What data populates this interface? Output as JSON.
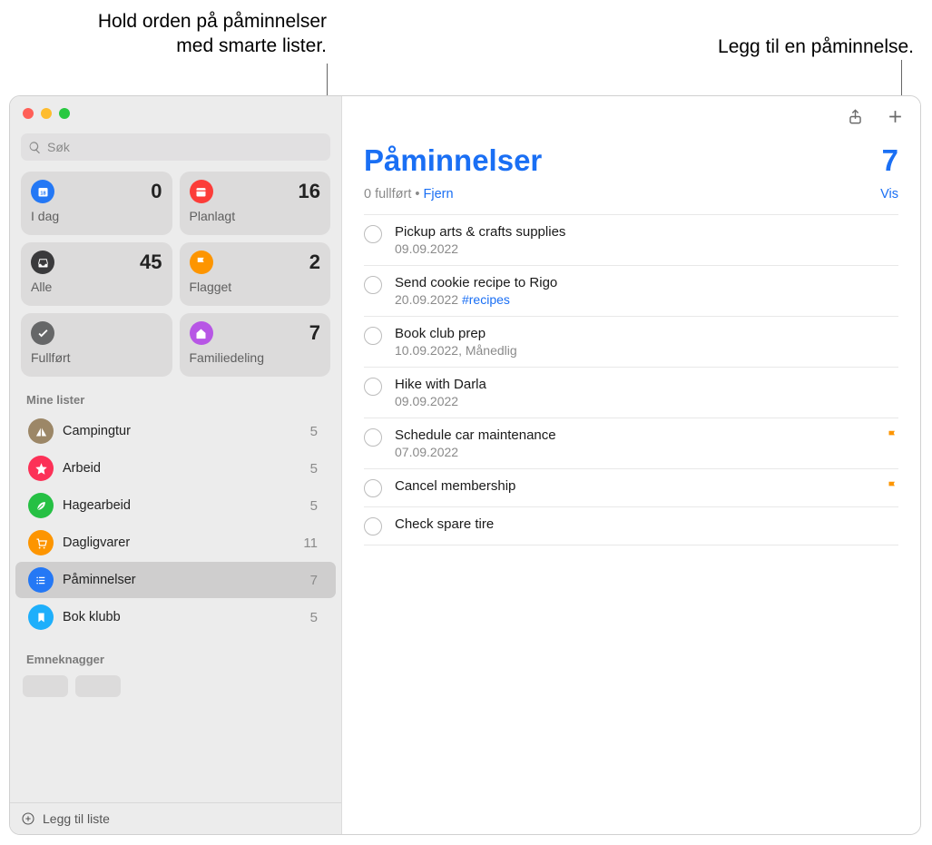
{
  "callouts": {
    "smart_lists": "Hold orden på påminnelser med smarte lister.",
    "add_reminder": "Legg til en påminnelse."
  },
  "search": {
    "placeholder": "Søk"
  },
  "smart": [
    {
      "label": "I dag",
      "count": "0",
      "color": "#2478f5",
      "icon": "today"
    },
    {
      "label": "Planlagt",
      "count": "16",
      "color": "#fc3d39",
      "icon": "calendar"
    },
    {
      "label": "Alle",
      "count": "45",
      "color": "#3a3a3c",
      "icon": "inbox"
    },
    {
      "label": "Flagget",
      "count": "2",
      "color": "#fd9500",
      "icon": "flag"
    },
    {
      "label": "Fullført",
      "count": "",
      "color": "#666768",
      "icon": "check"
    },
    {
      "label": "Familiedeling",
      "count": "7",
      "color": "#b756e5",
      "icon": "home"
    }
  ],
  "sections": {
    "mylists": "Mine lister",
    "tags": "Emneknagger"
  },
  "lists": [
    {
      "name": "Campingtur",
      "count": "5",
      "color": "#9c8767",
      "icon": "tent"
    },
    {
      "name": "Arbeid",
      "count": "5",
      "color": "#fc3157",
      "icon": "star"
    },
    {
      "name": "Hagearbeid",
      "count": "5",
      "color": "#26c044",
      "icon": "leaf"
    },
    {
      "name": "Dagligvarer",
      "count": "11",
      "color": "#fd9500",
      "icon": "cart"
    },
    {
      "name": "Påminnelser",
      "count": "7",
      "color": "#2478f5",
      "icon": "list",
      "selected": true
    },
    {
      "name": "Bok klubb",
      "count": "5",
      "color": "#1eaffb",
      "icon": "bookmark"
    }
  ],
  "footer": {
    "add_list": "Legg til liste"
  },
  "main": {
    "title": "Påminnelser",
    "count": "7",
    "completed_text": "0 fullført",
    "clear": "Fjern",
    "show": "Vis"
  },
  "reminders": [
    {
      "title": "Pickup arts & crafts supplies",
      "meta": "09.09.2022",
      "flag": false
    },
    {
      "title": "Send cookie recipe to Rigo",
      "meta": "20.09.2022",
      "tag": "#recipes",
      "flag": false
    },
    {
      "title": "Book club prep",
      "meta": "10.09.2022, Månedlig",
      "flag": false
    },
    {
      "title": "Hike with Darla",
      "meta": "09.09.2022",
      "flag": false
    },
    {
      "title": "Schedule car maintenance",
      "meta": "07.09.2022",
      "flag": true
    },
    {
      "title": "Cancel membership",
      "meta": "",
      "flag": true
    },
    {
      "title": "Check spare tire",
      "meta": "",
      "flag": false
    }
  ]
}
